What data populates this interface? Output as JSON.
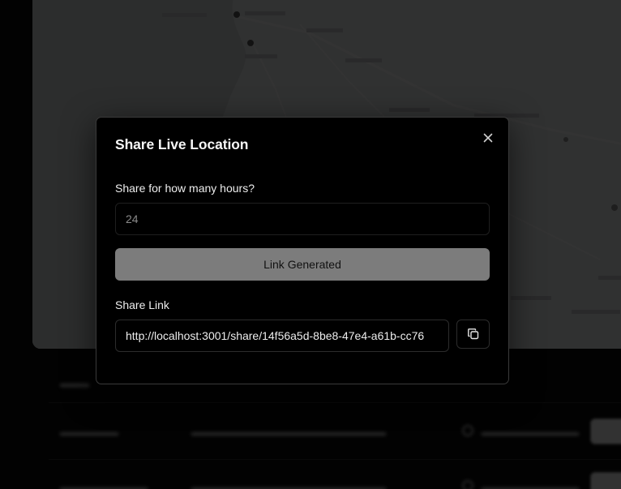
{
  "modal": {
    "title": "Share Live Location",
    "hours_label": "Share for how many hours?",
    "hours_value": "24",
    "generate_button_label": "Link Generated",
    "share_link_label": "Share Link",
    "share_link_value": "http://localhost:3001/share/14f56a5d-8be8-47e4-a61b-cc76"
  },
  "icons": {
    "close": "close-icon",
    "copy": "copy-icon"
  },
  "colors": {
    "modal_background": "#000000",
    "modal_border": "#3a3a3a",
    "button_background": "#7c7c7c",
    "overlay": "rgba(0,0,0,0.78)"
  }
}
